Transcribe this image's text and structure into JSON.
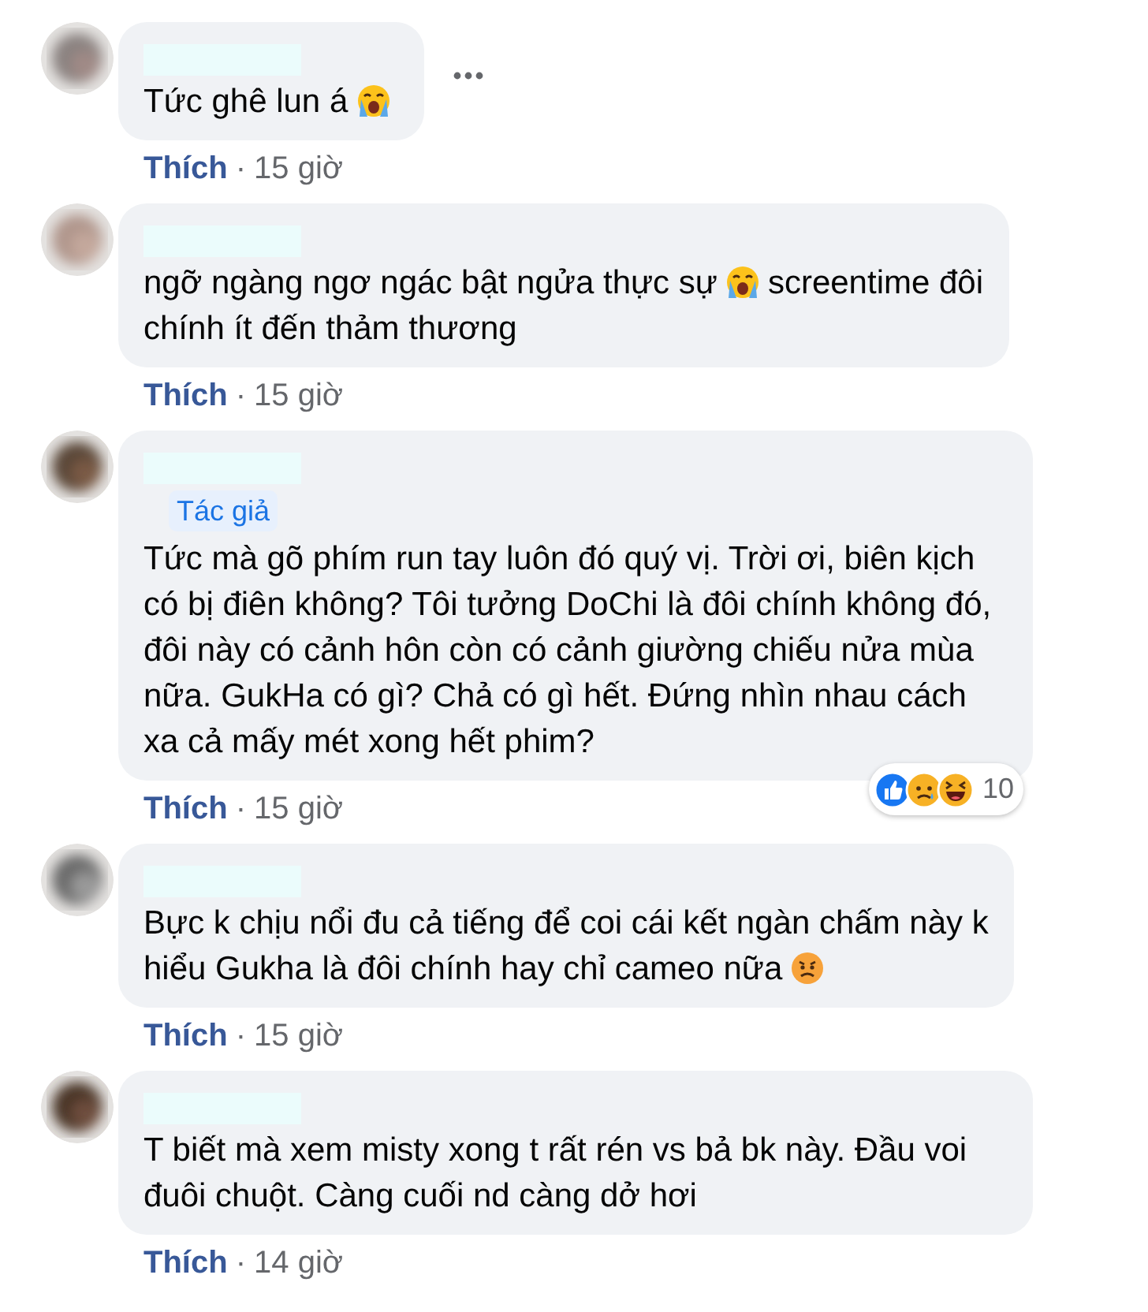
{
  "comments": [
    {
      "content": [
        {
          "kind": "text",
          "text": "Tức ghê lun á"
        },
        {
          "kind": "crying-emoji"
        }
      ],
      "options_visible": true,
      "like": "Thích",
      "separator": "·",
      "time": "15 giờ"
    },
    {
      "content": [
        {
          "kind": "text",
          "text": "ngỡ ngàng ngơ ngác bật ngửa thực sự"
        },
        {
          "kind": "crying-emoji"
        },
        {
          "kind": "text",
          "text": "screentime đôi"
        },
        {
          "kind": "break"
        },
        {
          "kind": "text",
          "text": "chính ít đến thảm thương"
        }
      ],
      "options_visible": false,
      "like": "Thích",
      "separator": "·",
      "time": "15 giờ"
    },
    {
      "badge": "Tác giả",
      "content": [
        {
          "kind": "paragraph",
          "text": "Tức mà gõ phím run tay luôn đó quý vị. Trời ơi, biên kịch có bị điên không? Tôi tưởng DoChi là đôi chính không đó, đôi này có cảnh hôn còn có cảnh giường chiếu nửa mùa nữa. GukHa có gì? Chả có gì hết. Đứng nhìn nhau cách xa cả mấy mét xong hết phim?"
        }
      ],
      "options_visible": false,
      "reactions": {
        "count": "10"
      },
      "like": "Thích",
      "separator": "·",
      "time": "15 giờ"
    },
    {
      "content": [
        {
          "kind": "text",
          "text": "Bực k chịu nổi đu cả tiếng để coi cái kết ngàn chấm này k"
        },
        {
          "kind": "break"
        },
        {
          "kind": "text",
          "text": "hiểu Gukha là đôi chính hay chỉ cameo nữa"
        },
        {
          "kind": "frowning-emoji"
        }
      ],
      "options_visible": false,
      "like": "Thích",
      "separator": "·",
      "time": "15 giờ"
    },
    {
      "content": [
        {
          "kind": "paragraph",
          "text": "T biết mà xem misty xong t rất rén vs bả bk này. Đầu voi đuôi chuột. Càng cuối nd càng dở hơi"
        }
      ],
      "options_visible": false,
      "like": "Thích",
      "separator": "·",
      "time": "14 giờ"
    }
  ]
}
